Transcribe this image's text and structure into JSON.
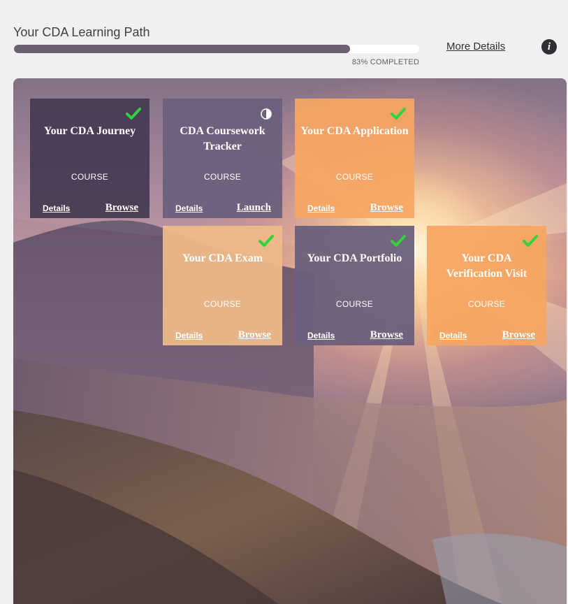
{
  "header": {
    "title": "Your CDA Learning Path",
    "progress_percent": 83,
    "progress_text": "83% COMPLETED",
    "more_details_label": "More Details",
    "info_icon": "info-icon"
  },
  "colors": {
    "progress_fill": "#6a6072",
    "check_green": "#2fd33a",
    "tile_dark": "#483c54",
    "tile_mid": "#6c607c",
    "tile_orange": "#f6a662",
    "tile_peach": "#eeba88"
  },
  "tiles": [
    {
      "title": "Your CDA Journey",
      "type": "COURSE",
      "details_label": "Details",
      "action_label": "Browse",
      "status_icon": "check-icon"
    },
    {
      "title": "CDA Coursework Tracker",
      "type": "COURSE",
      "details_label": "Details",
      "action_label": "Launch",
      "status_icon": "half-circle-icon"
    },
    {
      "title": "Your CDA Application",
      "type": "COURSE",
      "details_label": "Details",
      "action_label": "Browse",
      "status_icon": "check-icon"
    },
    {
      "title": "Your CDA Exam",
      "type": "COURSE",
      "details_label": "Details",
      "action_label": "Browse",
      "status_icon": "check-icon"
    },
    {
      "title": "Your CDA Portfolio",
      "type": "COURSE",
      "details_label": "Details",
      "action_label": "Browse",
      "status_icon": "check-icon"
    },
    {
      "title": "Your CDA Verification Visit",
      "type": "COURSE",
      "details_label": "Details",
      "action_label": "Browse",
      "status_icon": "check-icon"
    }
  ]
}
